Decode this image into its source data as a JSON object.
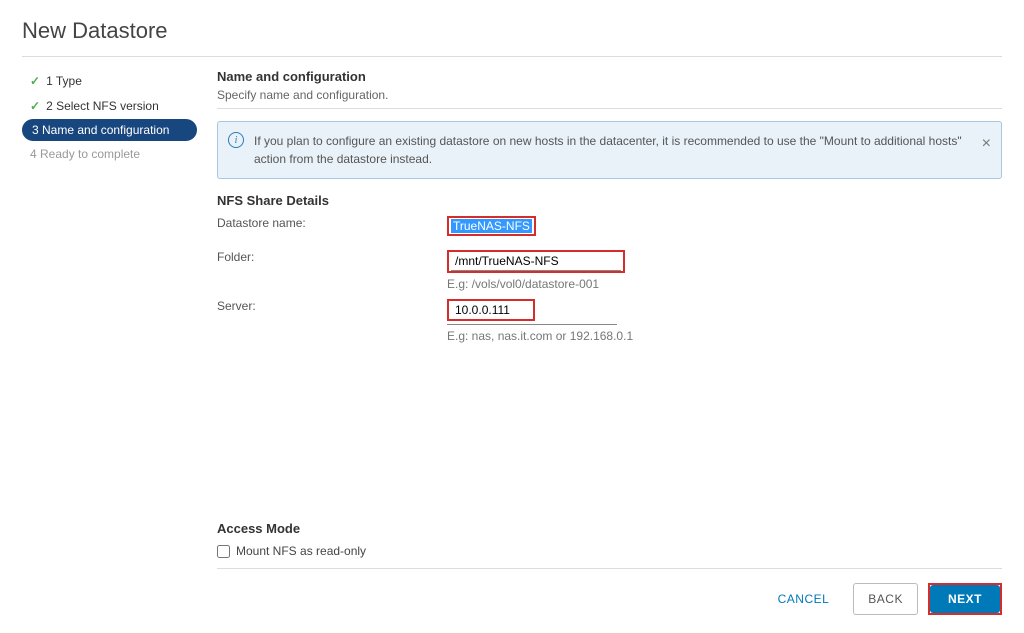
{
  "dialog": {
    "title": "New Datastore"
  },
  "wizard": {
    "steps": [
      {
        "label": "1 Type"
      },
      {
        "label": "2 Select NFS version"
      },
      {
        "label": "3 Name and configuration"
      },
      {
        "label": "4 Ready to complete"
      }
    ]
  },
  "section": {
    "title": "Name and configuration",
    "desc": "Specify name and configuration."
  },
  "info": {
    "text": "If you plan to configure an existing datastore on new hosts in the datacenter, it is recommended to use the \"Mount to additional hosts\" action from the datastore instead."
  },
  "nfs_section": {
    "title": "NFS Share Details",
    "datastore_label": "Datastore name:",
    "datastore_value": "TrueNAS-NFS",
    "folder_label": "Folder:",
    "folder_value": "/mnt/TrueNAS-NFS",
    "folder_hint": "E.g: /vols/vol0/datastore-001",
    "server_label": "Server:",
    "server_value": "10.0.0.111",
    "server_hint": "E.g: nas, nas.it.com or 192.168.0.1"
  },
  "access_mode": {
    "title": "Access Mode",
    "readonly_label": "Mount NFS as read-only"
  },
  "buttons": {
    "cancel": "CANCEL",
    "back": "BACK",
    "next": "NEXT"
  }
}
